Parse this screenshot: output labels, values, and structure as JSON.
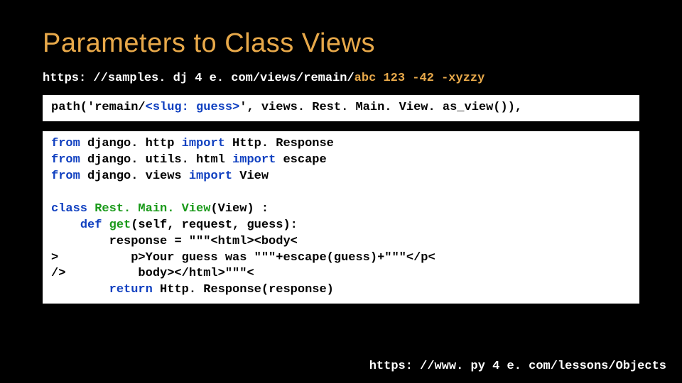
{
  "title": "Parameters to Class Views",
  "url": {
    "prefix": "https: //samples. dj 4 e. com/views/remain/",
    "suffix": "abc 123 -42 -xyzzy"
  },
  "route": {
    "p1": "path('remain/",
    "slug": "<slug: guess>",
    "p2": "', views. Rest. Main. View. as_view()),"
  },
  "code": {
    "from": "from",
    "import": "import",
    "class": "class",
    "def": "def",
    "return": "return",
    "d_http": " django. http ",
    "httpresp": " Http. Response",
    "d_utils": " django. utils. html ",
    "escape": " escape",
    "d_views": " django. views ",
    "view": " View",
    "classname": " Rest. Main. View",
    "classtail": "(View) :",
    "defline": "get",
    "defargs": "(self, request, guess):",
    "resp1": "response = \"\"\"<html><body<",
    "resp2": ">          p>Your guess was \"\"\"+escape(guess)+\"\"\"</p<",
    "resp3": "/>          body></html>\"\"\"<",
    "ret": " Http. Response(response)"
  },
  "footer": "https: //www. py 4 e. com/lessons/Objects"
}
